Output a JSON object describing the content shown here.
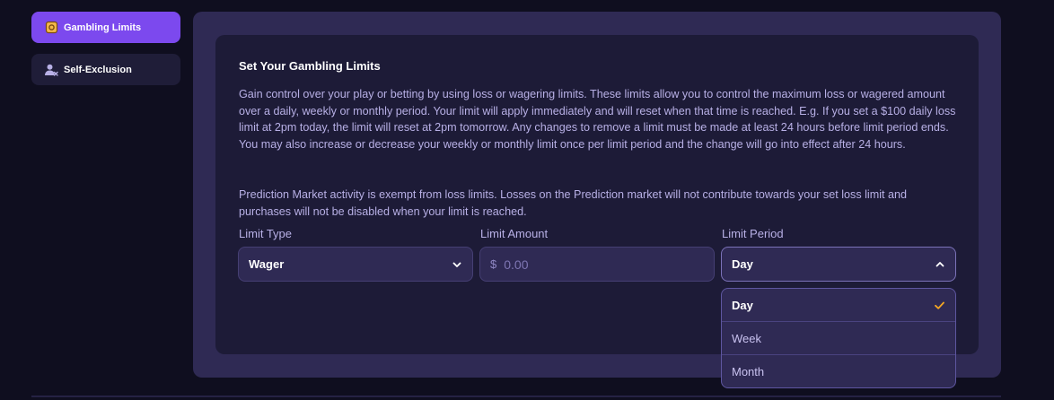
{
  "sidebar": {
    "items": [
      {
        "label": "Gambling Limits",
        "icon": "wallet-icon",
        "active": true
      },
      {
        "label": "Self-Exclusion",
        "icon": "user-x-icon",
        "active": false
      }
    ]
  },
  "main": {
    "title": "Set Your Gambling Limits",
    "description": "Gain control over your play or betting by using loss or wagering limits. These limits allow you to control the maximum loss or wagered amount over a daily, weekly or monthly period. Your limit will apply immediately and will reset when that time is reached. E.g. If you set a $100 daily loss limit at 2pm today, the limit will reset at 2pm tomorrow. Any changes to remove a limit must be made at least 24 hours before limit period ends. You may also increase or decrease your weekly or monthly limit once per limit period and the change will go into effect after 24 hours.",
    "prediction_note": "Prediction Market activity is exempt from loss limits. Losses on the Prediction market will not contribute towards your set loss limit and purchases will not be disabled when your limit is reached.",
    "limit_type": {
      "label": "Limit Type",
      "value": "Wager"
    },
    "limit_amount": {
      "label": "Limit Amount",
      "currency": "$",
      "placeholder": "0.00",
      "value": ""
    },
    "limit_period": {
      "label": "Limit Period",
      "value": "Day",
      "options": [
        "Day",
        "Week",
        "Month"
      ],
      "selected": "Day",
      "open": true
    }
  },
  "colors": {
    "accent": "#7c49ee",
    "background": "#0f0e1f",
    "panel": "#2f2a54",
    "card": "#1d1b37",
    "check": "#f5a623",
    "icon_gold": "#f5b84a"
  }
}
